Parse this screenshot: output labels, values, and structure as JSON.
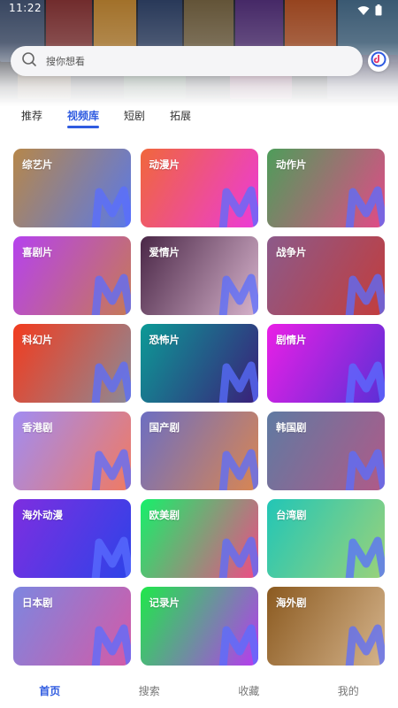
{
  "status": {
    "time": "11:22",
    "wifi_icon": "wifi-icon",
    "battery_icon": "battery-icon"
  },
  "search": {
    "placeholder": "搜你想看",
    "icon": "search-icon"
  },
  "tabs": [
    {
      "label": "推荐",
      "active": false
    },
    {
      "label": "视频库",
      "active": true
    },
    {
      "label": "短剧",
      "active": false
    },
    {
      "label": "拓展",
      "active": false
    }
  ],
  "categories": [
    {
      "label": "综艺片",
      "from": "#b6874a",
      "to": "#5a79e8"
    },
    {
      "label": "动漫片",
      "from": "#f0673b",
      "to": "#ec3bd9"
    },
    {
      "label": "动作片",
      "from": "#4e9d5a",
      "to": "#e24a88"
    },
    {
      "label": "喜剧片",
      "from": "#b542ee",
      "to": "#c67a55"
    },
    {
      "label": "爱情片",
      "from": "#4a2747",
      "to": "#d7b3cc"
    },
    {
      "label": "战争片",
      "from": "#8c5a8a",
      "to": "#c23d3d"
    },
    {
      "label": "科幻片",
      "from": "#f23b1e",
      "to": "#8c8a96"
    },
    {
      "label": "恐怖片",
      "from": "#0c9a96",
      "to": "#3a1f7a"
    },
    {
      "label": "剧情片",
      "from": "#ea1fe6",
      "to": "#5a2fd6"
    },
    {
      "label": "香港剧",
      "from": "#a18cf2",
      "to": "#f07a62"
    },
    {
      "label": "国产剧",
      "from": "#6c6ec2",
      "to": "#d98652"
    },
    {
      "label": "韩国剧",
      "from": "#5f7aa2",
      "to": "#b05a88"
    },
    {
      "label": "海外动漫",
      "from": "#7e2ee0",
      "to": "#2d43e8"
    },
    {
      "label": "欧美剧",
      "from": "#16f06a",
      "to": "#f04a86"
    },
    {
      "label": "台湾剧",
      "from": "#22c6b6",
      "to": "#9ad27a"
    },
    {
      "label": "日本剧",
      "from": "#7d86e0",
      "to": "#d45aa6"
    },
    {
      "label": "记录片",
      "from": "#1fe84a",
      "to": "#b83af0"
    },
    {
      "label": "海外剧",
      "from": "#8b5a20",
      "to": "#d5b48c"
    }
  ],
  "bottom_nav": [
    {
      "label": "首页",
      "active": true
    },
    {
      "label": "搜索",
      "active": false
    },
    {
      "label": "收藏",
      "active": false
    },
    {
      "label": "我的",
      "active": false
    }
  ],
  "colors": {
    "accent": "#2f5be0"
  }
}
